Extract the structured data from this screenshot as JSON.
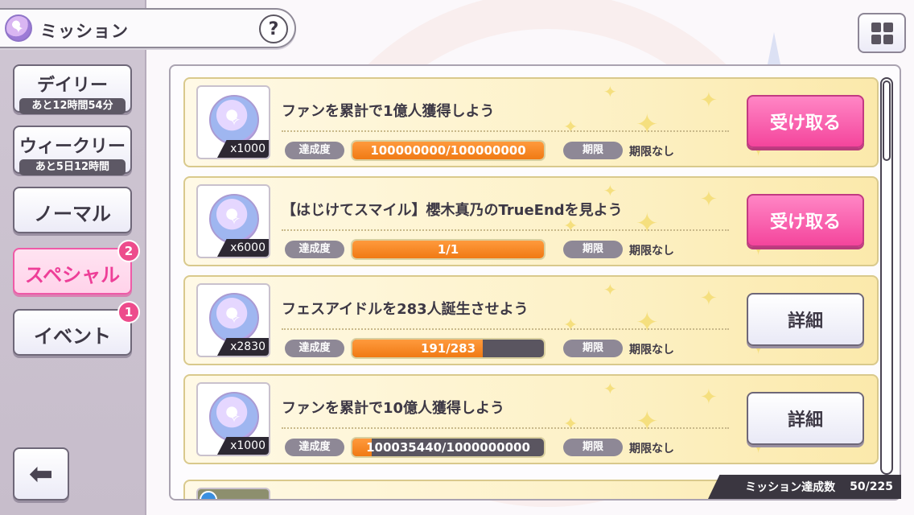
{
  "header": {
    "title": "ミッション",
    "help_label": "?",
    "menu_icon": "grid-icon"
  },
  "sidebar": {
    "tabs": [
      {
        "label": "デイリー",
        "timer": "あと12時間54分"
      },
      {
        "label": "ウィークリー",
        "timer": "あと5日12時間"
      },
      {
        "label": "ノーマル"
      },
      {
        "label": "スペシャル",
        "badge": "2",
        "active": true
      },
      {
        "label": "イベント",
        "badge": "1"
      }
    ],
    "back_icon": "arrow-left-icon"
  },
  "missions": [
    {
      "title": "ファンを累計で1億人獲得しよう",
      "reward_qty": "x1000",
      "achieve_label": "達成度",
      "progress_text": "100000000/100000000",
      "progress": 1.0,
      "deadline_label": "期限",
      "deadline_value": "期限なし",
      "action": "受け取る",
      "action_type": "claim"
    },
    {
      "title": "【はじけてスマイル】櫻木真乃のTrueEndを見よう",
      "reward_qty": "x6000",
      "achieve_label": "達成度",
      "progress_text": "1/1",
      "progress": 1.0,
      "deadline_label": "期限",
      "deadline_value": "期限なし",
      "action": "受け取る",
      "action_type": "claim"
    },
    {
      "title": "フェスアイドルを283人誕生させよう",
      "reward_qty": "x2830",
      "achieve_label": "達成度",
      "progress_text": "191/283",
      "progress": 0.675,
      "deadline_label": "期限",
      "deadline_value": "期限なし",
      "action": "詳細",
      "action_type": "detail"
    },
    {
      "title": "ファンを累計で10億人獲得しよう",
      "reward_qty": "x1000",
      "achieve_label": "達成度",
      "progress_text": "100035440/1000000000",
      "progress": 0.1,
      "deadline_label": "期限",
      "deadline_value": "期限なし",
      "action": "詳細",
      "action_type": "detail"
    }
  ],
  "footer": {
    "label": "ミッション達成数",
    "count": "50/225"
  },
  "colors": {
    "accent_pink": "#f4459c",
    "progress_orange": "#f07a14",
    "card_yellow": "#fdf2c9"
  }
}
